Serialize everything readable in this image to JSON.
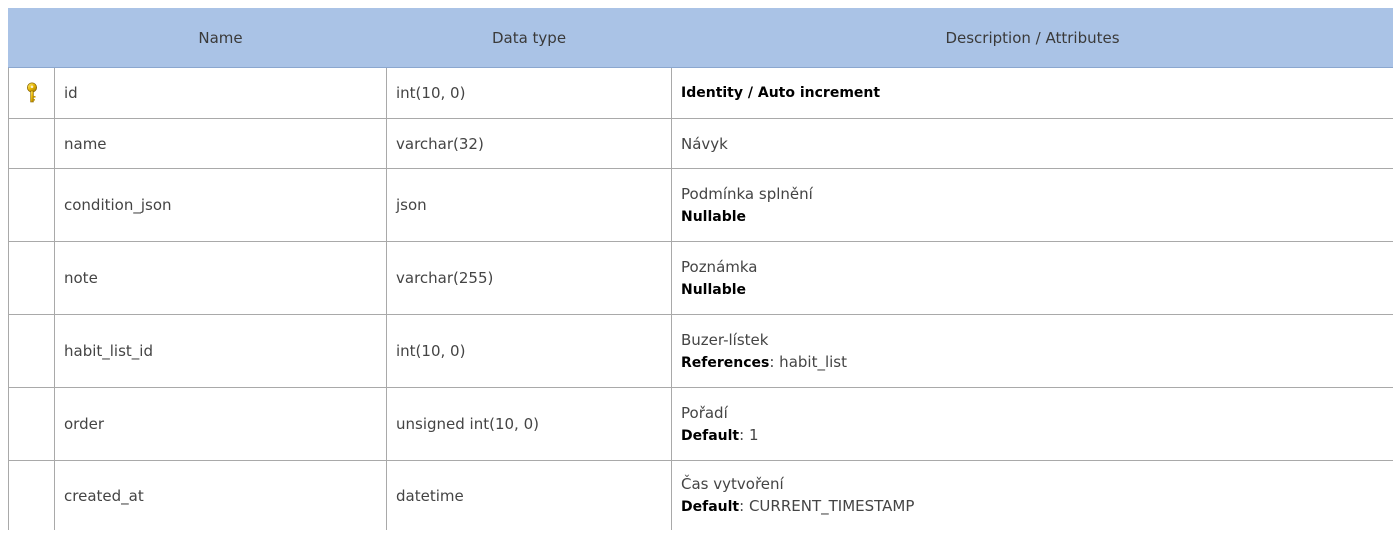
{
  "header": {
    "name": "Name",
    "data_type": "Data type",
    "description": "Description / Attributes"
  },
  "rows": [
    {
      "key_icon": "primary-key-icon",
      "name": "id",
      "type": "int(10, 0)",
      "description": "",
      "attr_label": "Identity / Auto increment",
      "attr_value": ""
    },
    {
      "name": "name",
      "type": "varchar(32)",
      "description": "Návyk"
    },
    {
      "name": "condition_json",
      "type": "json",
      "description": "Podmínka splnění",
      "attr_label": "Nullable",
      "attr_value": ""
    },
    {
      "name": "note",
      "type": "varchar(255)",
      "description": "Poznámka",
      "attr_label": "Nullable",
      "attr_value": ""
    },
    {
      "name": "habit_list_id",
      "type": "int(10, 0)",
      "description": "Buzer-lístek",
      "attr_label": "References",
      "attr_value": ": habit_list"
    },
    {
      "name": "order",
      "type": "unsigned int(10, 0)",
      "description": "Pořadí",
      "attr_label": "Default",
      "attr_value": ": 1"
    },
    {
      "name": "created_at",
      "type": "datetime",
      "description": "Čas vytvoření",
      "attr_label": "Default",
      "attr_value": ": CURRENT_TIMESTAMP"
    }
  ],
  "colors": {
    "header_bg": "#aac3e6",
    "border": "#a9a9a9",
    "key_icon": "#e6b400"
  }
}
